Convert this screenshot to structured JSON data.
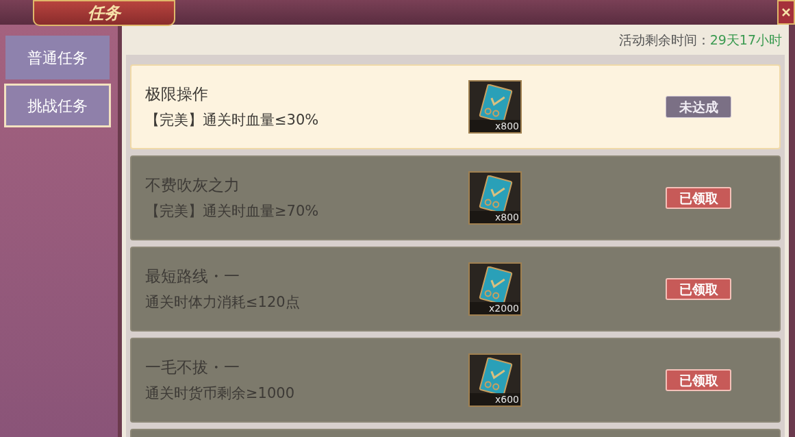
{
  "window": {
    "title": "任务"
  },
  "tabs": [
    {
      "label": "普通任务",
      "selected": false
    },
    {
      "label": "挑战任务",
      "selected": true
    }
  ],
  "time_left": {
    "label": "活动剩余时间：",
    "value": "29天17小时"
  },
  "tasks": [
    {
      "title": "极限操作",
      "requirement": "【完美】通关时血量≤30%",
      "reward_count": "x800",
      "kind": "unfinished",
      "status_label": "未达成"
    },
    {
      "title": "不费吹灰之力",
      "requirement": "【完美】通关时血量≥70%",
      "reward_count": "x800",
      "kind": "claimed",
      "status_label": "已领取"
    },
    {
      "title": "最短路线・一",
      "requirement": "通关时体力消耗≤120点",
      "reward_count": "x2000",
      "kind": "claimed",
      "status_label": "已领取"
    },
    {
      "title": "一毛不拔・一",
      "requirement": "通关时货币剩余≥1000",
      "reward_count": "x600",
      "kind": "claimed",
      "status_label": "已领取"
    }
  ]
}
